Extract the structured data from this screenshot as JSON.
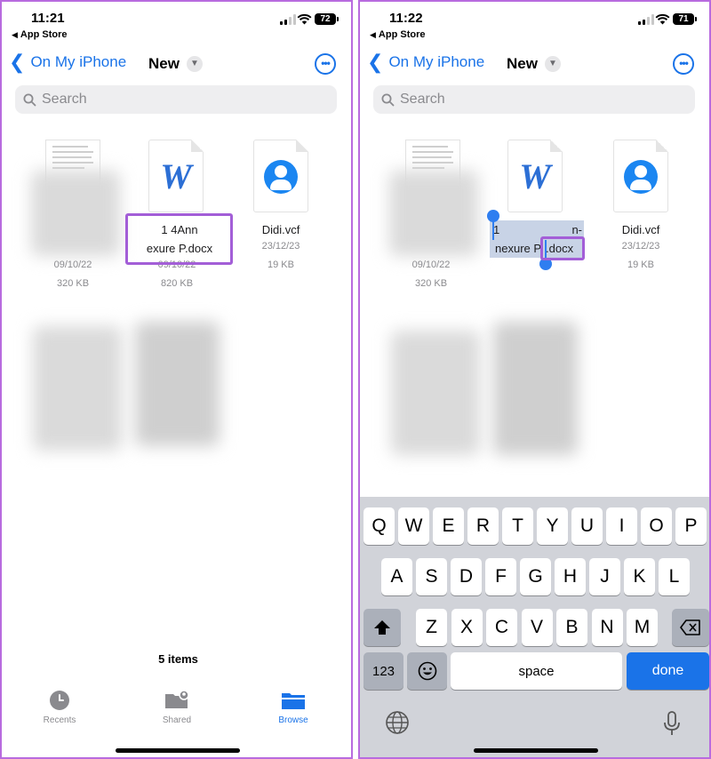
{
  "left": {
    "time": "11:21",
    "back_app": "App Store",
    "battery": "72",
    "nav_back": "On My iPhone",
    "title": "New",
    "search_placeholder": "Search",
    "files": [
      {
        "name": "",
        "date": "09/10/22",
        "size": "320 KB"
      },
      {
        "name_line1": "1             4Ann",
        "name_line2": "exure P.docx",
        "date": "09/10/22",
        "size": "820 KB"
      },
      {
        "name": "Didi.vcf",
        "date": "23/12/23",
        "size": "19 KB"
      }
    ],
    "items_count": "5 items",
    "tabs": [
      {
        "label": "Recents",
        "icon": "clock-icon"
      },
      {
        "label": "Shared",
        "icon": "shared-folder-icon"
      },
      {
        "label": "Browse",
        "icon": "folder-icon"
      }
    ]
  },
  "right": {
    "time": "11:22",
    "back_app": "App Store",
    "battery": "71",
    "nav_back": "On My iPhone",
    "title": "New",
    "search_placeholder": "Search",
    "files": [
      {
        "name": "",
        "date": "09/10/22",
        "size": "320 KB"
      },
      {
        "name_line1_start": "1",
        "name_line1_end": "n-",
        "name_line2_prefix": "nexure P",
        "name_line2_suffix": ".docx"
      },
      {
        "name": "Didi.vcf",
        "date": "23/12/23",
        "size": "19 KB"
      }
    ],
    "keyboard": {
      "row1": [
        "Q",
        "W",
        "E",
        "R",
        "T",
        "Y",
        "U",
        "I",
        "O",
        "P"
      ],
      "row2": [
        "A",
        "S",
        "D",
        "F",
        "G",
        "H",
        "J",
        "K",
        "L"
      ],
      "row3": [
        "Z",
        "X",
        "C",
        "V",
        "B",
        "N",
        "M"
      ],
      "numbers": "123",
      "space": "space",
      "done": "done"
    }
  },
  "colors": {
    "accent": "#1a73e8",
    "highlight": "#a35ed7",
    "selection": "#c8d3e6"
  }
}
